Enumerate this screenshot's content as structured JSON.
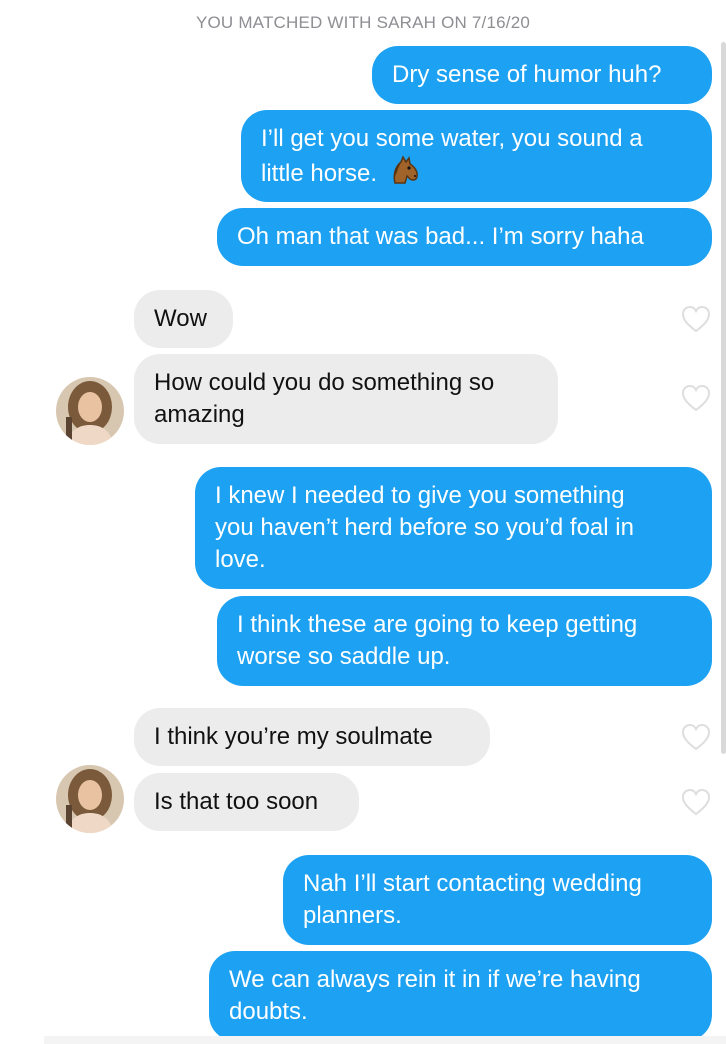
{
  "match_header": "YOU MATCHED WITH SARAH ON 7/16/20",
  "colors": {
    "sent_bubble": "#1da1f2",
    "received_bubble": "#ececec",
    "header_text": "#8e8e93"
  },
  "icons": {
    "reaction": "heart-outline-icon",
    "emoji": "horse-face-emoji"
  },
  "messages": [
    {
      "from": "me",
      "lines": [
        "Dry sense of humor huh?"
      ]
    },
    {
      "from": "me",
      "lines": [
        "I’ll get you some water, you sound a",
        "little horse."
      ],
      "emoji": "horse-face-emoji"
    },
    {
      "from": "me",
      "lines": [
        "Oh man that was bad... I’m sorry haha"
      ]
    },
    {
      "from": "sarah",
      "lines": [
        "Wow"
      ]
    },
    {
      "from": "sarah",
      "lines": [
        "How could you do something so",
        "amazing"
      ]
    },
    {
      "from": "me",
      "lines": [
        "I knew I needed to give you something",
        "you haven’t herd before so you’d foal in",
        "love."
      ]
    },
    {
      "from": "me",
      "lines": [
        "I think these are going to keep getting",
        "worse so saddle up."
      ]
    },
    {
      "from": "sarah",
      "lines": [
        "I think you’re my soulmate"
      ]
    },
    {
      "from": "sarah",
      "lines": [
        "Is that too soon"
      ]
    },
    {
      "from": "me",
      "lines": [
        "Nah I’ll start contacting wedding",
        "planners."
      ]
    },
    {
      "from": "me",
      "lines": [
        "We can always rein it in if we’re having",
        "doubts."
      ]
    }
  ]
}
